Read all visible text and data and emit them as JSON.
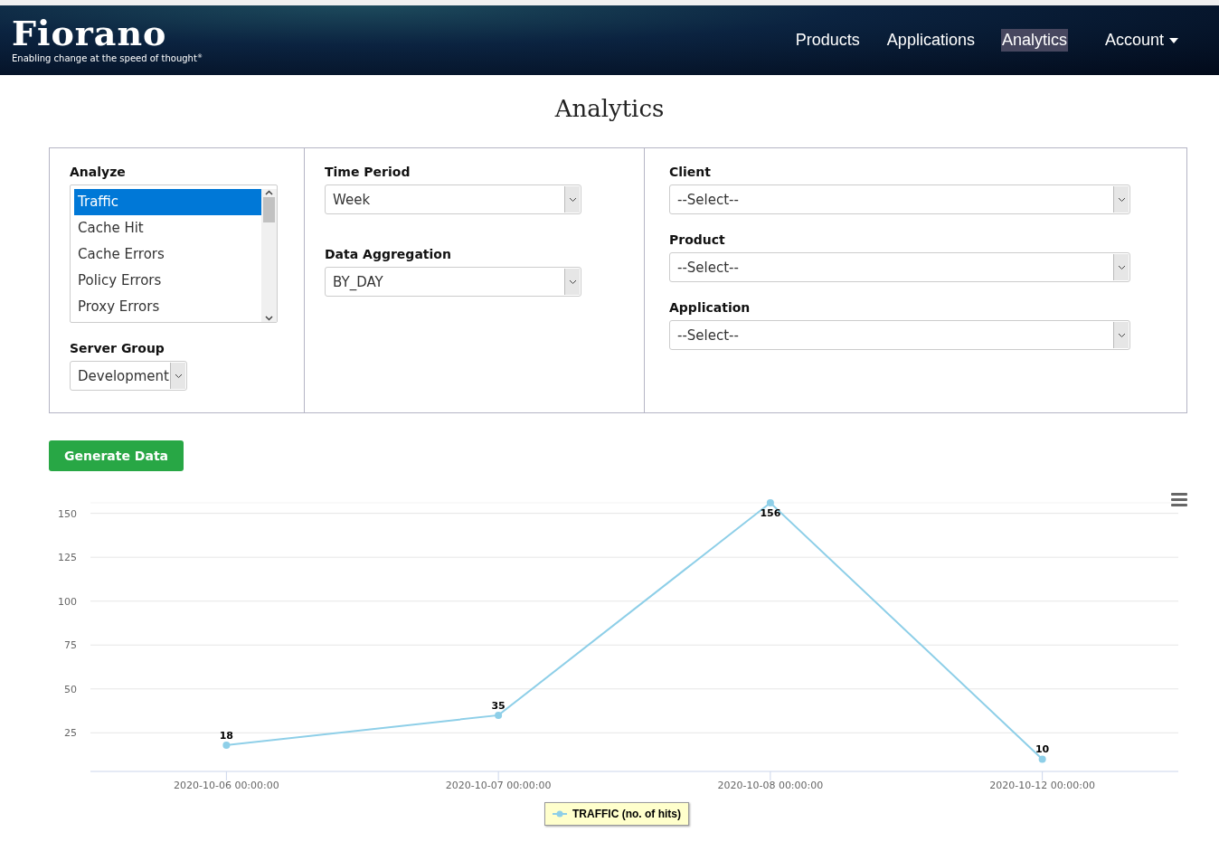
{
  "header": {
    "logo": "Fiorano",
    "tagline": "Enabling change at the speed of thought",
    "tagline_mark": "®",
    "nav": [
      {
        "label": "Products",
        "selected": false,
        "kind": "link"
      },
      {
        "label": "Applications",
        "selected": false,
        "kind": "link"
      },
      {
        "label": "Analytics",
        "selected": true,
        "kind": "link"
      },
      {
        "label": "Account",
        "selected": false,
        "kind": "dropdown"
      }
    ]
  },
  "title": "Analytics",
  "form": {
    "analyze": {
      "label": "Analyze",
      "items": [
        {
          "label": "Traffic",
          "selected": true
        },
        {
          "label": "Cache Hit",
          "selected": false
        },
        {
          "label": "Cache Errors",
          "selected": false
        },
        {
          "label": "Policy Errors",
          "selected": false
        },
        {
          "label": "Proxy Errors",
          "selected": false
        }
      ]
    },
    "server_group": {
      "label": "Server Group",
      "value": "Development"
    },
    "time_period": {
      "label": "Time Period",
      "value": "Week"
    },
    "data_aggregation": {
      "label": "Data Aggregation",
      "value": "BY_DAY"
    },
    "client": {
      "label": "Client",
      "value": "--Select--"
    },
    "product": {
      "label": "Product",
      "value": "--Select--"
    },
    "application": {
      "label": "Application",
      "value": "--Select--"
    }
  },
  "generate_button": "Generate Data",
  "chart_data": {
    "type": "line",
    "categories": [
      "2020-10-06 00:00:00",
      "2020-10-07 00:00:00",
      "2020-10-08 00:00:00",
      "2020-10-12 00:00:00"
    ],
    "series": [
      {
        "name": "TRAFFIC (no. of hits)",
        "color": "#8ecfe8",
        "marker": true,
        "values": [
          18,
          35,
          156,
          10
        ]
      }
    ],
    "ylim": [
      3,
      156
    ],
    "yticks": [
      25,
      50,
      75,
      100,
      125,
      150
    ],
    "grid": true,
    "data_labels": true
  }
}
